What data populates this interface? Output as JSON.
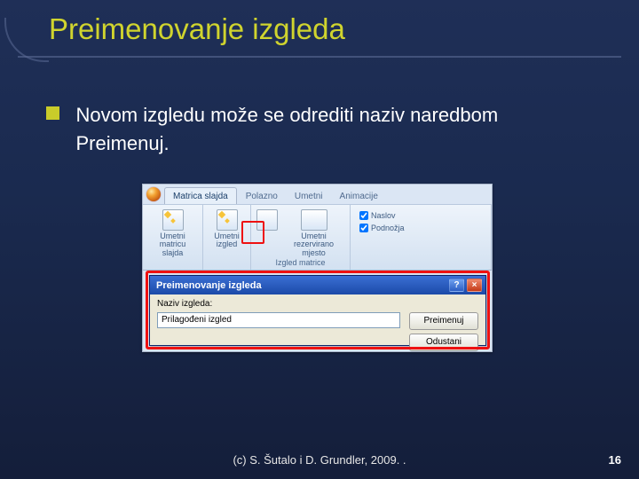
{
  "slide": {
    "title": "Preimenovanje izgleda",
    "bullet": "Novom izgledu može se odrediti naziv naredbom Preimenuj.",
    "footer": "(c) S. Šutalo i D. Grundler, 2009. .",
    "page_number": "16"
  },
  "powerpoint": {
    "tabs": {
      "active": "Matrica slajda",
      "others": [
        "Polazno",
        "Umetni",
        "Animacije"
      ]
    },
    "groups": {
      "umetni_matricu": {
        "label": "Umetni matricu slajda",
        "button": "Umetni matricu slajda"
      },
      "umetni_izgled": {
        "label": "Umetni izgled",
        "button": "Umetni izgled"
      },
      "izgled_matrice": {
        "label": "Izgled matrice",
        "button": "Umetni rezervirano mjesto"
      },
      "checkboxes": {
        "naslov": "Naslov",
        "podnozja": "Podnožja"
      }
    },
    "dialog": {
      "title": "Preimenovanje izgleda",
      "field_label": "Naziv izgleda:",
      "field_value": "Prilagođeni izgled",
      "ok": "Preimenuj",
      "cancel": "Odustani",
      "help_char": "?",
      "close_char": "×"
    }
  }
}
